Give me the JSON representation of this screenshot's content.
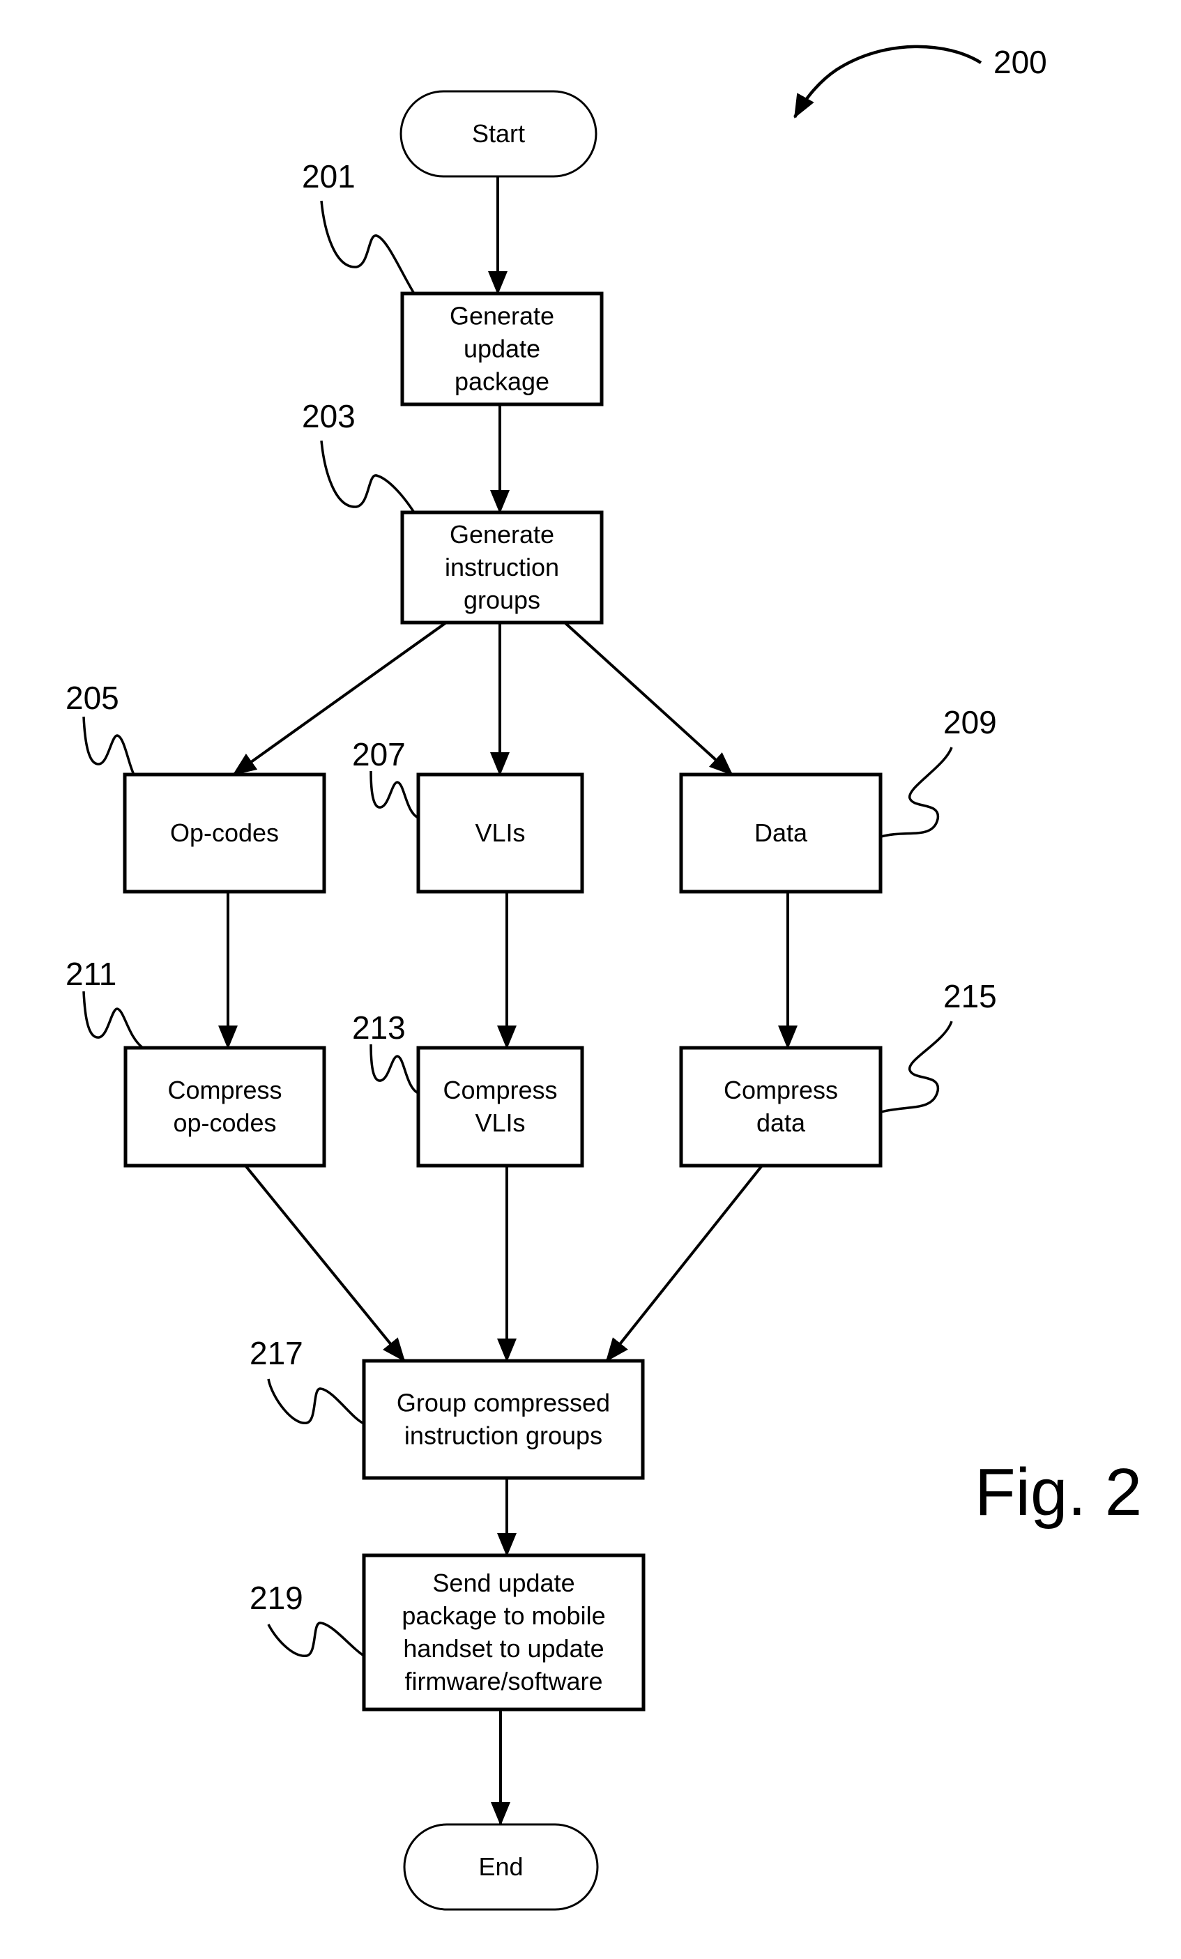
{
  "figure": {
    "reference": "200",
    "label": "Fig. 2"
  },
  "nodes": {
    "start": {
      "lines": [
        "Start"
      ]
    },
    "n201": {
      "ref": "201",
      "lines": [
        "Generate",
        "update",
        "package"
      ]
    },
    "n203": {
      "ref": "203",
      "lines": [
        "Generate",
        "instruction",
        "groups"
      ]
    },
    "n205": {
      "ref": "205",
      "lines": [
        "Op-codes"
      ]
    },
    "n207": {
      "ref": "207",
      "lines": [
        "VLIs"
      ]
    },
    "n209": {
      "ref": "209",
      "lines": [
        "Data"
      ]
    },
    "n211": {
      "ref": "211",
      "lines": [
        "Compress",
        "op-codes"
      ]
    },
    "n213": {
      "ref": "213",
      "lines": [
        "Compress",
        "VLIs"
      ]
    },
    "n215": {
      "ref": "215",
      "lines": [
        "Compress",
        "data"
      ]
    },
    "n217": {
      "ref": "217",
      "lines": [
        "Group compressed",
        "instruction groups"
      ]
    },
    "n219": {
      "ref": "219",
      "lines": [
        "Send update",
        "package to mobile",
        "handset to update",
        "firmware/software"
      ]
    },
    "end": {
      "lines": [
        "End"
      ]
    }
  },
  "edges": [
    [
      "start",
      "n201"
    ],
    [
      "n201",
      "n203"
    ],
    [
      "n203",
      "n205"
    ],
    [
      "n203",
      "n207"
    ],
    [
      "n203",
      "n209"
    ],
    [
      "n205",
      "n211"
    ],
    [
      "n207",
      "n213"
    ],
    [
      "n209",
      "n215"
    ],
    [
      "n211",
      "n217"
    ],
    [
      "n213",
      "n217"
    ],
    [
      "n215",
      "n217"
    ],
    [
      "n217",
      "n219"
    ],
    [
      "n219",
      "end"
    ]
  ]
}
